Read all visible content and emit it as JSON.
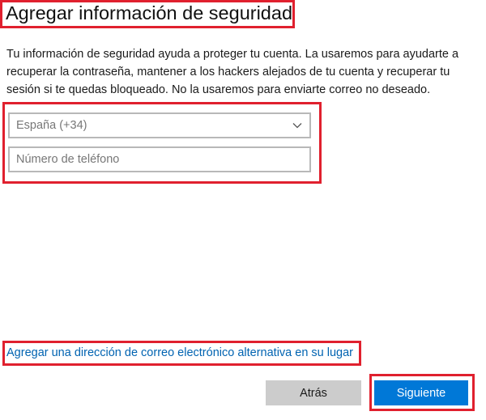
{
  "header": {
    "title": "Agregar información de seguridad"
  },
  "description": "Tu información de seguridad ayuda a proteger tu cuenta. La usaremos para ayudarte a recuperar la contraseña, mantener a los hackers alejados de tu cuenta y recuperar tu sesión si te quedas bloqueado. No la usaremos para enviarte correo no deseado.",
  "form": {
    "country_selected": "España (+34)",
    "phone_placeholder": "Número de teléfono",
    "phone_value": ""
  },
  "links": {
    "alternate_email": "Agregar una dirección de correo electrónico alternativa en su lugar"
  },
  "buttons": {
    "back_label": "Atrás",
    "next_label": "Siguiente"
  },
  "colors": {
    "highlight": "#e0202e",
    "accent": "#0078d7",
    "link": "#0063b1",
    "secondary_button": "#cccccc"
  },
  "icons": {
    "dropdown": "chevron-down-icon"
  }
}
